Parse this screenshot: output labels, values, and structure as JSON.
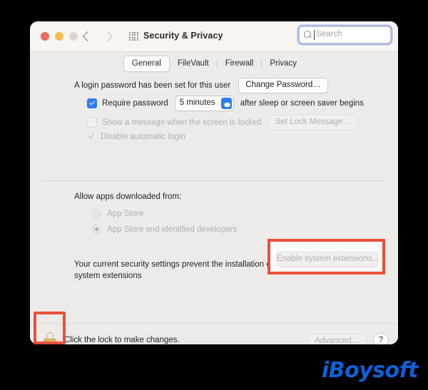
{
  "window": {
    "title": "Security & Privacy",
    "traffic_lights": [
      "close",
      "minimize",
      "zoom"
    ],
    "nav": {
      "back": "back-arrow",
      "forward": "forward-arrow"
    },
    "grid_icon": "grid-icon",
    "search": {
      "placeholder": "Search",
      "value": "",
      "icon": "search-icon"
    }
  },
  "tabs": [
    {
      "label": "General",
      "selected": true
    },
    {
      "label": "FileVault",
      "selected": false
    },
    {
      "label": "Firewall",
      "selected": false
    },
    {
      "label": "Privacy",
      "selected": false
    }
  ],
  "general": {
    "password_status": "A login password has been set for this user",
    "change_password_button": "Change Password…",
    "require_password": {
      "label": "Require password",
      "checked": true,
      "interval": "5 minutes",
      "suffix": "after sleep or screen saver begins"
    },
    "lock_message": {
      "label": "Show a message when the screen is locked",
      "checked": false,
      "button": "Set Lock Message…",
      "disabled": true
    },
    "disable_auto_login": {
      "label": "Disable automatic login",
      "checked": true,
      "disabled": true
    },
    "allow_apps_heading": "Allow apps downloaded from:",
    "allow_apps_options": [
      {
        "label": "App Store",
        "selected": false
      },
      {
        "label": "App Store and identified developers",
        "selected": true
      }
    ],
    "system_extensions": {
      "message_line1": "Your current security settings prevent the installation of",
      "message_line2": "system extensions",
      "button": "Enable system extensions…",
      "button_disabled": true,
      "highlighted": true
    }
  },
  "bottom": {
    "lock_icon": "lock-closed-icon",
    "lock_text": "Click the lock to make changes.",
    "advanced_button": "Advanced…",
    "advanced_disabled": true,
    "help_button": "?"
  },
  "watermark": {
    "text": "iBoysoft"
  },
  "colors": {
    "accent_blue": "#2f7cf6",
    "highlight_red": "#e8503a",
    "lock_gold": "#e2b75f",
    "window_bg": "#ecebe9",
    "titlebar_bg": "#f7f4f2",
    "watermark_blue": "#1060d8"
  }
}
